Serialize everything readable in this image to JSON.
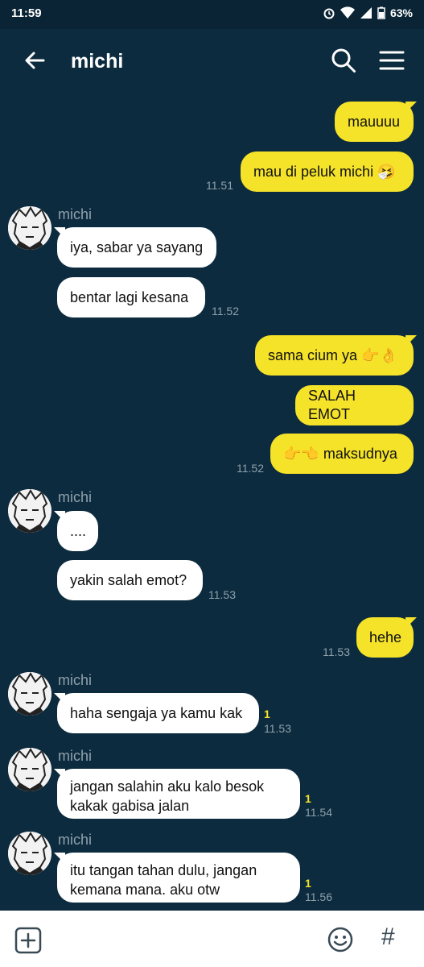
{
  "status": {
    "time": "11:59",
    "battery": "63%"
  },
  "header": {
    "title": "michi"
  },
  "messages": {
    "m1": "mauuuu",
    "m2": "mau di peluk michi 🤧",
    "t1": "11.51",
    "s1": "michi",
    "m3": "iya, sabar ya sayang",
    "m4": "bentar lagi kesana",
    "t2": "11.52",
    "m5": "sama cium ya 👉👌",
    "m6": "SALAH EMOT",
    "m7": "👉👈 maksudnya",
    "t3": "11.52",
    "s2": "michi",
    "m8": "....",
    "m9": "yakin salah emot?",
    "t4": "11.53",
    "m10": "hehe",
    "t5": "11.53",
    "s3": "michi",
    "m11": "haha sengaja ya kamu kak",
    "r1": "1",
    "t6": "11.53",
    "s4": "michi",
    "m12a": "jangan salahin aku kalo besok",
    "m12b": "kakak gabisa jalan",
    "r2": "1",
    "t7": "11.54",
    "s5": "michi",
    "m13a": "itu tangan tahan dulu, jangan",
    "m13b": "kemana mana. aku otw",
    "r3": "1",
    "t8": "11.56"
  },
  "icons": {
    "back": "arrow-left-icon",
    "search": "search-icon",
    "menu": "hamburger-menu-icon",
    "plus": "plus-square-icon",
    "emoji": "smiley-icon",
    "hash": "hash-icon"
  },
  "colors": {
    "background": "#0d2b3e",
    "outgoing": "#f5e32a",
    "incoming": "#ffffff"
  }
}
